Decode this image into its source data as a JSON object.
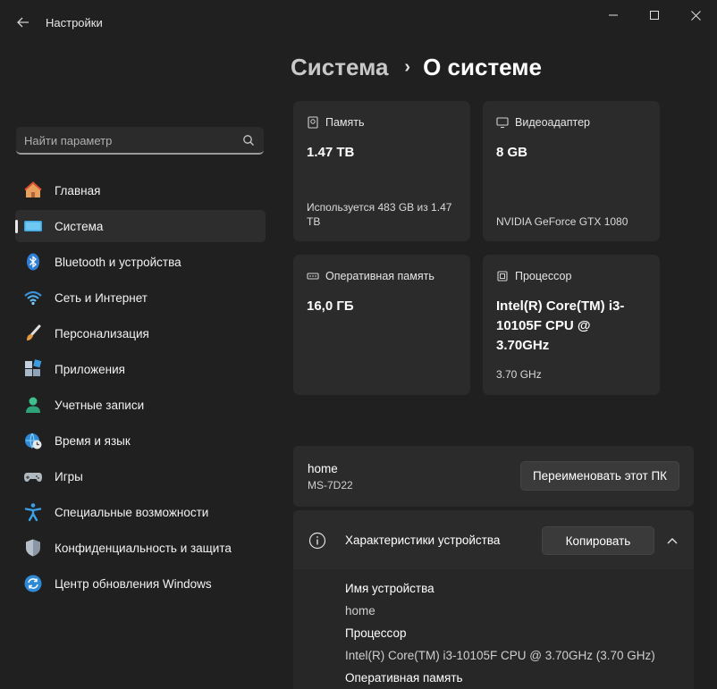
{
  "window": {
    "title": "Настройки",
    "minimize": "minimize",
    "maximize": "maximize",
    "close": "close"
  },
  "search": {
    "placeholder": "Найти параметр"
  },
  "sidebar": {
    "items": [
      {
        "label": "Главная",
        "icon": "home-icon"
      },
      {
        "label": "Система",
        "icon": "system-icon",
        "active": true
      },
      {
        "label": "Bluetooth и устройства",
        "icon": "bluetooth-icon"
      },
      {
        "label": "Сеть и Интернет",
        "icon": "wifi-icon"
      },
      {
        "label": "Персонализация",
        "icon": "brush-icon"
      },
      {
        "label": "Приложения",
        "icon": "apps-icon"
      },
      {
        "label": "Учетные записи",
        "icon": "account-icon"
      },
      {
        "label": "Время и язык",
        "icon": "globe-clock-icon"
      },
      {
        "label": "Игры",
        "icon": "gamepad-icon"
      },
      {
        "label": "Специальные возможности",
        "icon": "accessibility-icon"
      },
      {
        "label": "Конфиденциальность и защита",
        "icon": "shield-icon"
      },
      {
        "label": "Центр обновления Windows",
        "icon": "update-icon"
      }
    ]
  },
  "breadcrumb": {
    "parent": "Система",
    "separator": "›",
    "current": "О системе"
  },
  "cards": {
    "storage": {
      "title": "Память",
      "value": "1.47 TB",
      "sub": "Используется 483 GB из 1.47 TB"
    },
    "gpu": {
      "title": "Видеоадаптер",
      "value": "8 GB",
      "sub": "NVIDIA GeForce GTX 1080"
    },
    "ram": {
      "title": "Оперативная память",
      "value": "16,0 ГБ"
    },
    "cpu": {
      "title": "Процессор",
      "value": "Intel(R) Core(TM) i3-10105F CPU @ 3.70GHz",
      "sub": "3.70 GHz"
    }
  },
  "pc": {
    "name": "home",
    "model": "MS-7D22",
    "rename_label": "Переименовать этот ПК"
  },
  "specs": {
    "title": "Характеристики устройства",
    "copy_label": "Копировать",
    "rows": [
      {
        "label": "Имя устройства",
        "value": "home"
      },
      {
        "label": "Процессор",
        "value": "Intel(R) Core(TM) i3-10105F CPU @ 3.70GHz (3.70 GHz)"
      },
      {
        "label": "Оперативная память",
        "value": ""
      }
    ]
  },
  "colors": {
    "accent": "#4cc2ff",
    "background": "#202020",
    "card": "#2b2b2b"
  }
}
